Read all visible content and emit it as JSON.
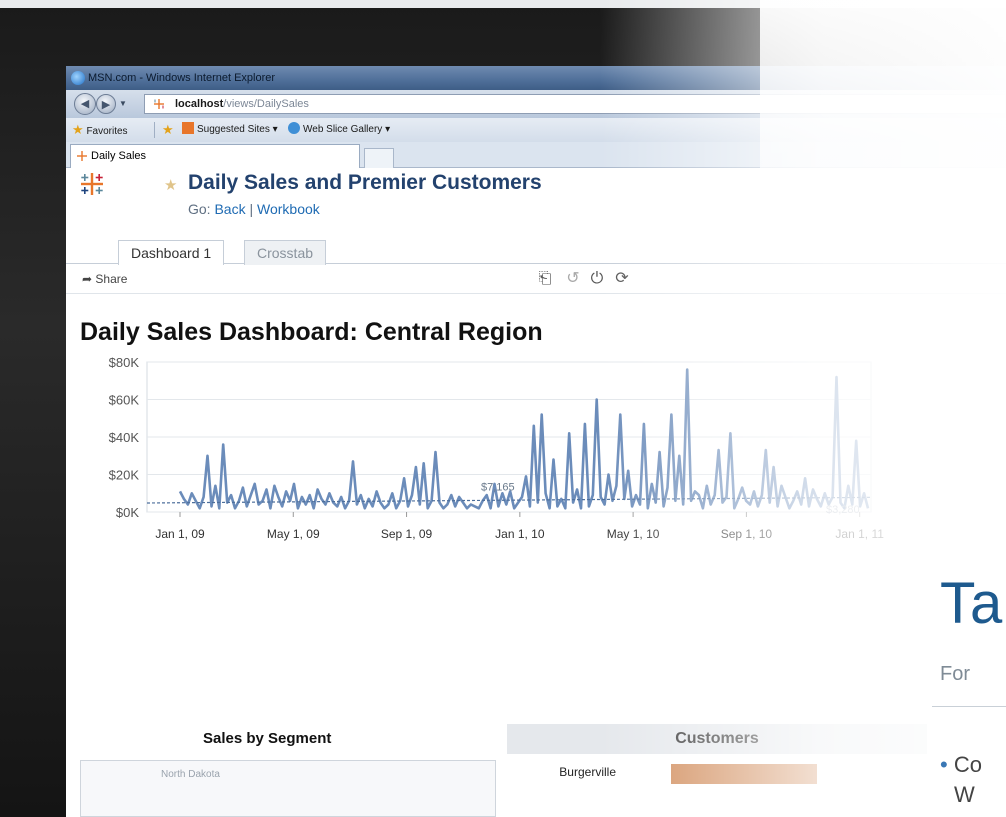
{
  "browser": {
    "window_title": "MSN.com - Windows Internet Explorer",
    "url_host": "localhost",
    "url_path": "/views/DailySales",
    "favorites_label": "Favorites",
    "suggested_sites": "Suggested Sites ▾",
    "web_slice_gallery": "Web Slice Gallery ▾",
    "tab_label": "Daily Sales"
  },
  "tableau": {
    "workbook_title": "Daily Sales and Premier Customers",
    "go_label": "Go:",
    "back_link": "Back",
    "separator": "|",
    "workbook_link": "Workbook",
    "sheet_tabs": [
      "Dashboard 1",
      "Crosstab"
    ],
    "share_label": "Share",
    "toolbar_icons": [
      "export-icon",
      "undo-icon",
      "revert-icon",
      "refresh-icon"
    ],
    "dashboard_title": "Daily Sales Dashboard: Central Region",
    "segment_title": "Sales by Segment",
    "segment_map_label": "North Dakota",
    "customers_header": "Customers",
    "customers": [
      {
        "name": "Burgerville"
      }
    ]
  },
  "overlay": {
    "title": "Ta",
    "subtitle": "For",
    "bullet": "Co",
    "bullet_line2": "W"
  },
  "colors": {
    "line": "#6b8cba",
    "title_blue": "#23426e",
    "bar_orange": "#d08a58"
  },
  "chart_data": {
    "type": "line",
    "title": "Daily Sales Dashboard: Central Region",
    "xlabel": "",
    "ylabel": "",
    "x_ticks": [
      "Jan 1, 09",
      "May 1, 09",
      "Sep 1, 09",
      "Jan 1, 10",
      "May 1, 10",
      "Sep 1, 10",
      "Jan 1, 11"
    ],
    "y_ticks": [
      "$0K",
      "$20K",
      "$40K",
      "$60K",
      "$80K"
    ],
    "ylim": [
      0,
      80000
    ],
    "annotations": [
      "$7,165",
      "$3,280"
    ],
    "series": [
      {
        "values": [
          11000,
          7000,
          4000,
          10000,
          6000,
          2000,
          8000,
          30000,
          3000,
          14000,
          2000,
          36000,
          5000,
          9000,
          2000,
          6000,
          13000,
          3000,
          9000,
          15000,
          4000,
          6000,
          12000,
          2000,
          14000,
          8000,
          3000,
          11000,
          6000,
          15000,
          2000,
          8000,
          4000,
          9000,
          2000,
          12000,
          7000,
          4000,
          10000,
          5000,
          3000,
          8000,
          2000,
          6000,
          27000,
          4000,
          9000,
          2000,
          7000,
          3000,
          11000,
          5000,
          2000,
          4000,
          10000,
          2000,
          6000,
          18000,
          3000,
          9000,
          24000,
          4000,
          26000,
          2000,
          6000,
          32000,
          5000,
          2000,
          4000,
          9000,
          3000,
          8000,
          5000,
          2000,
          4000,
          3000,
          2000,
          6000,
          9000,
          2000,
          15000,
          3000,
          10000,
          4000,
          11000,
          2000,
          5000,
          8000,
          19000,
          3000,
          46000,
          5000,
          52000,
          10000,
          2000,
          28000,
          3000,
          7000,
          2000,
          42000,
          5000,
          12000,
          2000,
          47000,
          3000,
          9000,
          60000,
          8000,
          4000,
          20000,
          6000,
          14000,
          52000,
          7000,
          22000,
          3000,
          9000,
          4000,
          47000,
          2000,
          15000,
          5000,
          32000,
          3000,
          13000,
          52000,
          6000,
          30000,
          4000,
          76000,
          6000,
          11000,
          9000,
          2000,
          14000,
          4000,
          9000,
          33000,
          5000,
          8000,
          42000,
          2000,
          7000,
          13000,
          6000,
          4000,
          11000,
          3000,
          9000,
          33000,
          5000,
          24000,
          3000,
          14000,
          8000,
          2000,
          6000,
          11000,
          4000,
          18000,
          3000,
          12000,
          7000,
          3000,
          10000,
          4000,
          8000,
          72000,
          5000,
          2000,
          14000,
          4000,
          38000,
          3000,
          10000,
          2000
        ]
      }
    ]
  }
}
